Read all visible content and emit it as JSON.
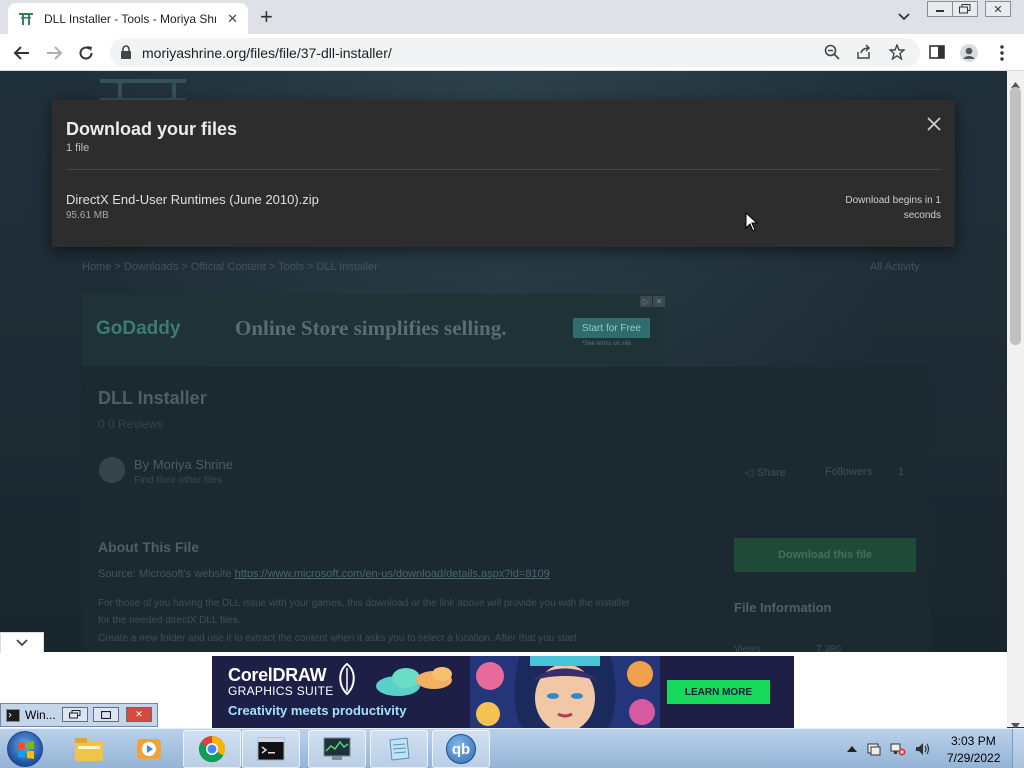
{
  "browser": {
    "tab_title": "DLL Installer - Tools - Moriya Shr",
    "url": "moriyashrine.org/files/file/37-dll-installer/"
  },
  "modal": {
    "title": "Download your files",
    "count": "1 file",
    "file_name": "DirectX End-User Runtimes (June 2010).zip",
    "file_size": "95.61 MB",
    "status": "Download begins in 1 seconds"
  },
  "page": {
    "breadcrumb": "Home  >  Downloads  >  Official Content  >  Tools  >  DLL Installer",
    "all_activity": "All Activity",
    "file_title": "DLL Installer",
    "file_subtitle": "0 0 Reviews",
    "author_name": "By Moriya Shrine",
    "author_sub": "Find their other files",
    "share": "Share",
    "followers": "Followers",
    "followers_count": "1",
    "about_title": "About This File",
    "source_prefix": "Source: Microsoft's website ",
    "source_link": "https://www.microsoft.com/en-us/download/details.aspx?id=8109",
    "desc_line_1": "For those of you having the DLL issue with your games, this download or the link above will provide you with the installer",
    "desc_line_2": "for the needed directX DLL files.",
    "desc_line_3": "Create a new folder and use it to extract the content when it asks you to select a location. After that you start",
    "download_button": "Download this file",
    "file_info_title": "File Information",
    "views_label": "Views",
    "views_value": "7,380"
  },
  "ads": {
    "godaddy_logo": "GoDaddy",
    "godaddy_text": "Online Store simplifies selling.",
    "godaddy_button": "Start for Free",
    "godaddy_small": "*See terms on site",
    "corel_name": "CorelDRAW",
    "corel_suite": "GRAPHICS SUITE",
    "corel_tag": "Creativity meets productivity",
    "corel_button": "LEARN MORE"
  },
  "mini_window": {
    "title": "Win..."
  },
  "taskbar": {
    "time": "3:03 PM",
    "date": "7/29/2022",
    "items": [
      "explorer-icon",
      "media-player-icon",
      "chrome-icon",
      "cmd-icon",
      "task-manager-icon",
      "notepad-icon",
      "qbittorrent-icon"
    ],
    "qb_label": "qb"
  },
  "colors": {
    "modal_bg": "#2d2d2d",
    "download_button": "#1f4a37",
    "corel_learn_more": "#16d95c",
    "taskbar": "#a6c2e0"
  }
}
